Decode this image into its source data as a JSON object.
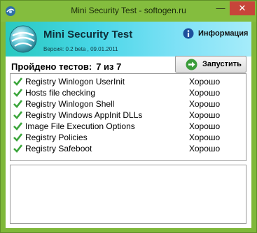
{
  "window": {
    "title": "Mini Security Test - softogen.ru",
    "controls": {
      "minimize": "—",
      "close": "✕"
    }
  },
  "banner": {
    "title": "Mini Security Test",
    "version": "Версия: 0.2 beta , 09.01.2011",
    "info_label": "Информация"
  },
  "summary": {
    "label": "Пройдено тестов:",
    "count": "7 из 7"
  },
  "run_button": {
    "label": "Запустить"
  },
  "colors": {
    "frame": "#84bd3e",
    "banner_start": "#29c9c0",
    "banner_end": "#a6ecfa",
    "check": "#3aa53a",
    "close_button": "#c7453a"
  },
  "results": [
    {
      "name": "Registry Winlogon UserInit",
      "status": "Хорошо",
      "icon": "check-icon"
    },
    {
      "name": "Hosts file checking",
      "status": "Хорошо",
      "icon": "check-icon"
    },
    {
      "name": "Registry Winlogon Shell",
      "status": "Хорошо",
      "icon": "check-icon"
    },
    {
      "name": "Registry Windows AppInit DLLs",
      "status": "Хорошо",
      "icon": "check-icon"
    },
    {
      "name": "Image File Execution Options",
      "status": "Хорошо",
      "icon": "check-icon"
    },
    {
      "name": "Registry Policies",
      "status": "Хорошо",
      "icon": "check-icon"
    },
    {
      "name": "Registry Safeboot",
      "status": "Хорошо",
      "icon": "check-icon"
    }
  ],
  "log": {
    "text": ""
  }
}
